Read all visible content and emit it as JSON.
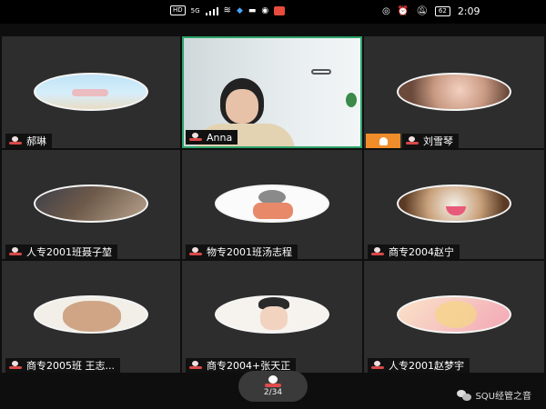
{
  "status_bar": {
    "left_badge": "HD",
    "network": "5G",
    "battery": "62",
    "time": "2:09"
  },
  "participants": [
    {
      "name": "郝琳",
      "avatar": "avatar-sky"
    },
    {
      "name": "Anna",
      "avatar": "video-feed"
    },
    {
      "name": "刘雪琴",
      "avatar": "avatar-girl"
    },
    {
      "name": "人专2001班聂子堃",
      "avatar": "avatar-anime"
    },
    {
      "name": "物专2001班汤志程",
      "avatar": "avatar-cartoon-boy"
    },
    {
      "name": "商专2004赵宁",
      "avatar": "avatar-dog"
    },
    {
      "name": "商专2005班 王志...",
      "avatar": "avatar-bear"
    },
    {
      "name": "商专2004+张天正",
      "avatar": "avatar-man-drawing"
    },
    {
      "name": "人专2001赵梦宇",
      "avatar": "avatar-anime-girl"
    }
  ],
  "pager": {
    "text": "2/34"
  },
  "watermark": {
    "text": "SQU经管之音"
  },
  "colors": {
    "active_border": "#2ea36b",
    "host_badge": "#f08c2a",
    "mute_red": "#d84848"
  }
}
